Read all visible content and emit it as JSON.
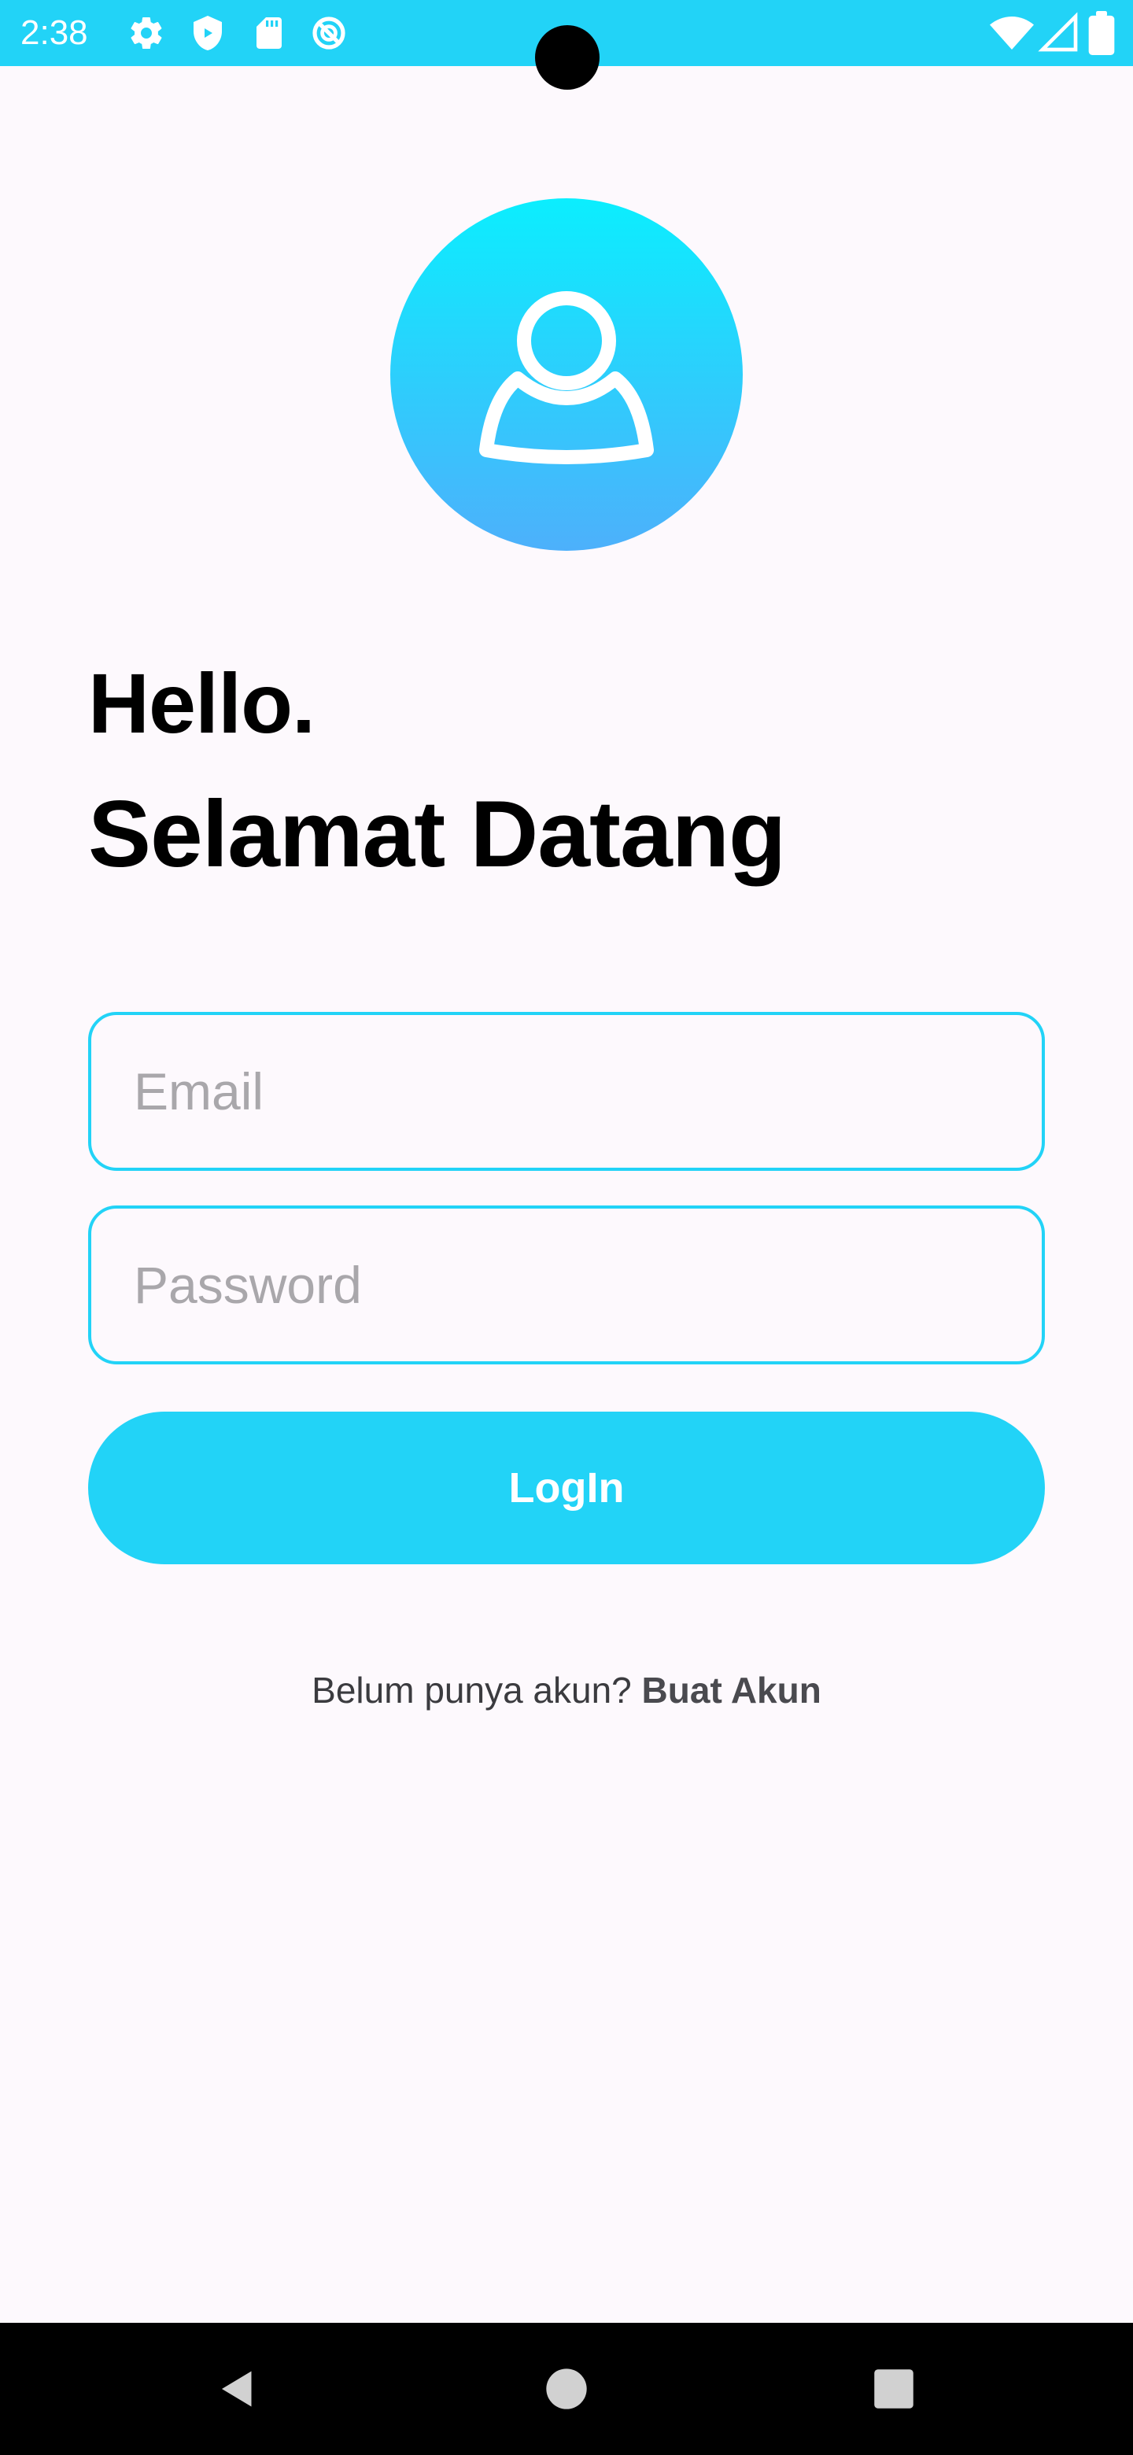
{
  "status_bar": {
    "time": "2:38",
    "left_icons": [
      "gear-icon",
      "shield-icon",
      "sd-card-icon",
      "do-not-disturb-icon"
    ],
    "right_icons": [
      "wifi-icon",
      "signal-icon",
      "battery-icon"
    ],
    "color": "#22d3f7"
  },
  "greeting": {
    "line1": "Hello.",
    "line2": "Selamat Datang"
  },
  "form": {
    "email_placeholder": "Email",
    "password_placeholder": "Password",
    "email_value": "",
    "password_value": "",
    "login_label": "LogIn"
  },
  "signup": {
    "prompt": "Belum punya akun? ",
    "link": "Buat Akun"
  },
  "nav": {
    "buttons": [
      "back-icon",
      "home-icon",
      "recents-icon"
    ]
  },
  "colors": {
    "accent": "#22d3f7",
    "avatar_top": "#0beefe",
    "avatar_bottom": "#4db0fb",
    "background": "#fdf9fd"
  }
}
